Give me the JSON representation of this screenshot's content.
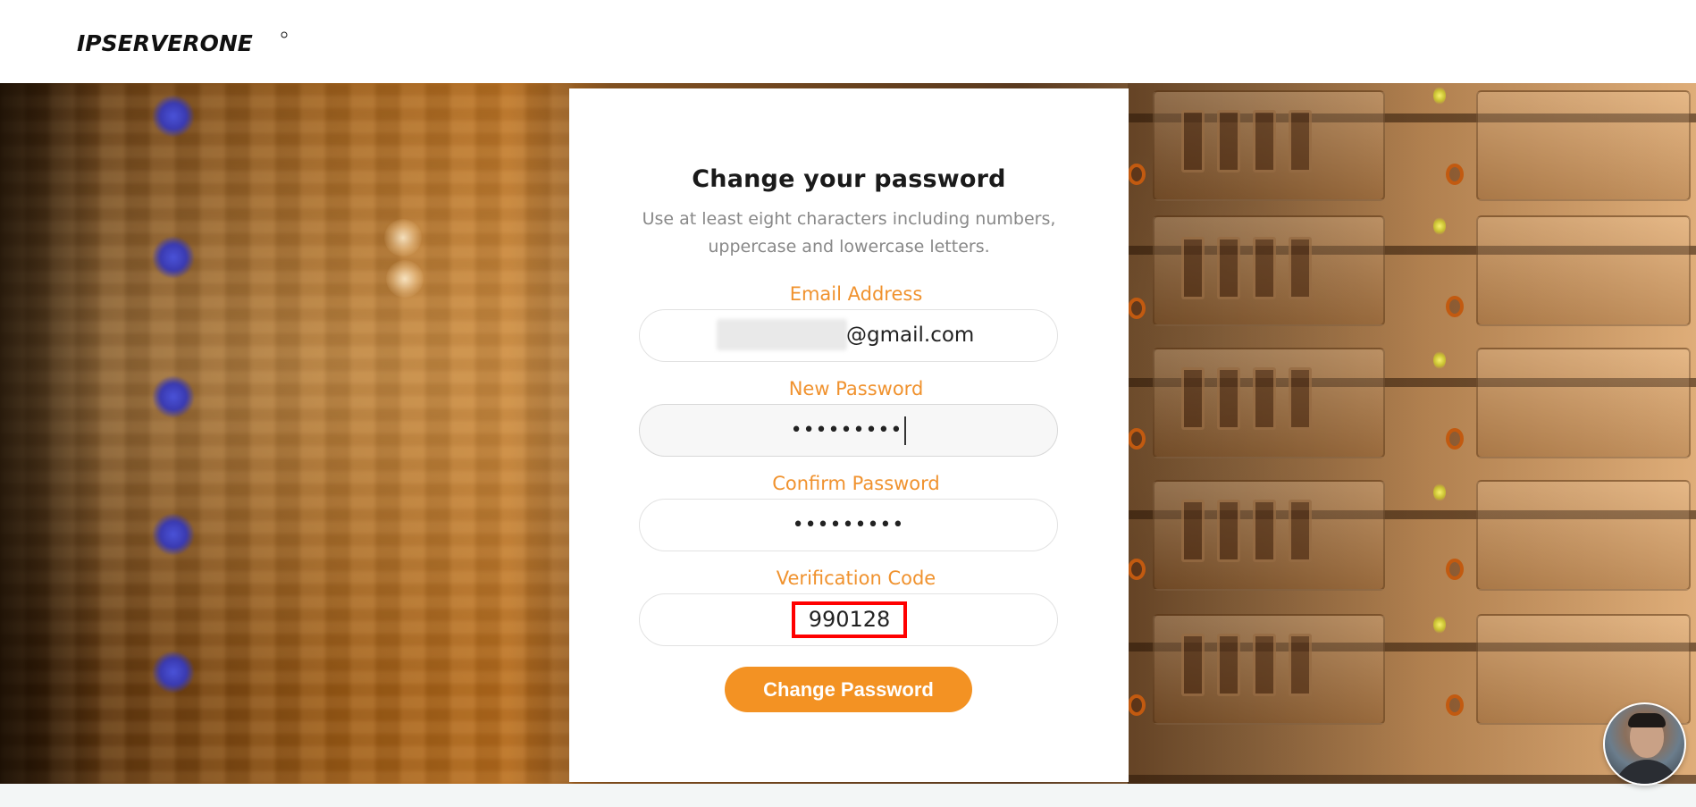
{
  "header": {
    "logo_text": "IPSERVERONE"
  },
  "form": {
    "title": "Change your password",
    "subtitle": "Use at least eight characters including numbers, uppercase and lowercase letters.",
    "email_label": "Email Address",
    "email_value": "@gmail.com",
    "new_password_label": "New Password",
    "new_password_value": "•••••••••",
    "confirm_password_label": "Confirm Password",
    "confirm_password_value": "•••••••••",
    "verification_label": "Verification Code",
    "verification_value": "990128",
    "submit_label": "Change Password"
  },
  "colors": {
    "accent": "#f39223",
    "label": "#f0922e",
    "highlight_border": "#ff0000"
  }
}
